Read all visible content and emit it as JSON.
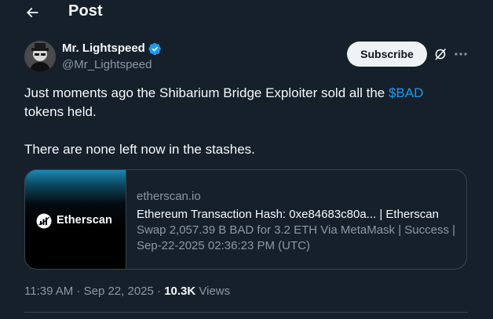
{
  "header": {
    "title": "Post"
  },
  "author": {
    "name": "Mr. Lightspeed",
    "handle": "@Mr_Lightspeed"
  },
  "actions": {
    "subscribe_label": "Subscribe"
  },
  "tweet": {
    "line1_before": "Just moments ago the Shibarium Bridge Exploiter sold all the ",
    "cashtag": "$BAD",
    "line1_after": " tokens held.",
    "line2": "There are none left now in the stashes."
  },
  "card": {
    "thumb_text": "Etherscan",
    "domain": "etherscan.io",
    "title": "Ethereum Transaction Hash: 0xe84683c80a... | Etherscan",
    "description_1": "Swap 2,057.39 B BAD for 3.2 ETH Via MetaMask | Success |",
    "description_2": "Sep-22-2025 02:36:23 PM (UTC)"
  },
  "meta": {
    "time": "11:39 AM",
    "date": "Sep 22, 2025",
    "sep1": " · ",
    "sep2": " · ",
    "views_count": "10.3K",
    "views_label": " Views"
  },
  "colors": {
    "background": "#15202b",
    "accent": "#1d9bf0",
    "secondary_text": "#8b98a5",
    "border": "#38444d"
  },
  "icons": [
    "back-arrow-icon",
    "verified-badge-icon",
    "grok-icon",
    "more-icon",
    "etherscan-logo-icon"
  ]
}
